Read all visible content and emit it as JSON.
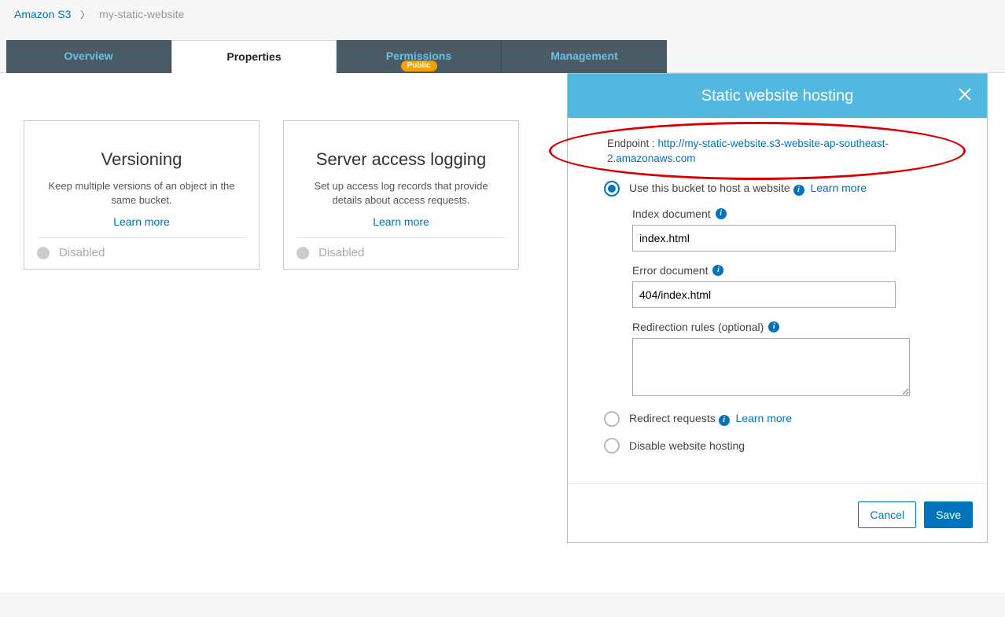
{
  "breadcrumb": {
    "root": "Amazon S3",
    "bucket": "my-static-website"
  },
  "tabs": {
    "overview": "Overview",
    "properties": "Properties",
    "permissions": "Permissions",
    "permissions_badge": "Public",
    "management": "Management"
  },
  "cards": {
    "versioning": {
      "title": "Versioning",
      "desc": "Keep multiple versions of an object in the same bucket.",
      "learn": "Learn more",
      "status": "Disabled"
    },
    "logging": {
      "title": "Server access logging",
      "desc": "Set up access log records that provide details about access requests.",
      "learn": "Learn more",
      "status": "Disabled"
    }
  },
  "panel": {
    "title": "Static website hosting",
    "endpoint_label": "Endpoint : ",
    "endpoint_url": "http://my-static-website.s3-website-ap-southeast-2.amazonaws.com",
    "opt_host_label": "Use this bucket to host a website",
    "opt_host_learn": "Learn more",
    "index_label": "Index document",
    "index_value": "index.html",
    "error_label": "Error document",
    "error_value": "404/index.html",
    "redirect_rules_label": "Redirection rules (optional)",
    "redirect_rules_value": "",
    "opt_redirect_label": "Redirect requests",
    "opt_redirect_learn": "Learn more",
    "opt_disable_label": "Disable website hosting",
    "cancel": "Cancel",
    "save": "Save"
  }
}
